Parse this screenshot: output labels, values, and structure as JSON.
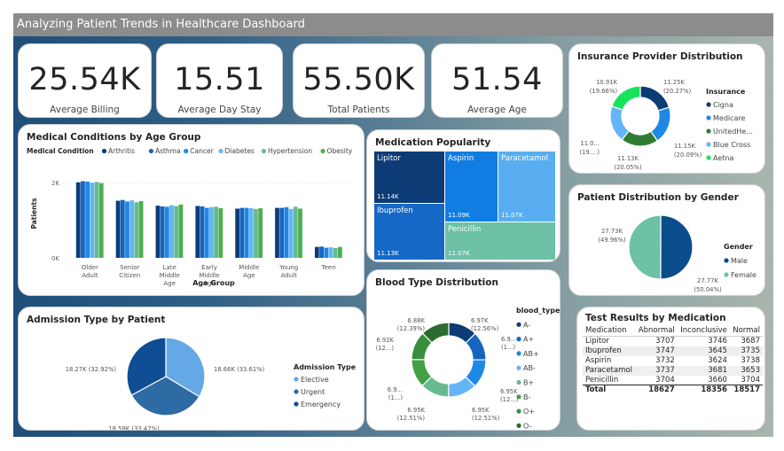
{
  "header": {
    "title": "Analyzing Patient Trends in Healthcare Dashboard"
  },
  "kpis": [
    {
      "value": "25.54K",
      "label": "Average Billing"
    },
    {
      "value": "15.51",
      "label": "Average Day Stay"
    },
    {
      "value": "55.50K",
      "label": "Total Patients"
    },
    {
      "value": "51.54",
      "label": "Average Age"
    }
  ],
  "medical_conditions": {
    "title": "Medical Conditions by Age Group",
    "legend_title": "Medical Condition",
    "xlabel": "Age Group",
    "ylabel": "Patients",
    "ytick_top": "2K",
    "ytick_bottom": "0K",
    "chart_data": {
      "type": "bar",
      "categories": [
        "Older Adult",
        "Senior Citizen",
        "Late Middle Age",
        "Early Middle Age",
        "Middle Age",
        "Young Adult",
        "Teen"
      ],
      "category_lines": [
        [
          "Older",
          "Adult"
        ],
        [
          "Senior",
          "Citizen"
        ],
        [
          "Late",
          "Middle",
          "Age"
        ],
        [
          "Early",
          "Middle",
          "Age"
        ],
        [
          "Middle",
          "Age"
        ],
        [
          "Young",
          "Adult"
        ],
        [
          "Teen"
        ]
      ],
      "series": [
        {
          "name": "Arthritis",
          "color": "#0b3d7a",
          "values": [
            2010,
            1520,
            1390,
            1380,
            1310,
            1330,
            290
          ]
        },
        {
          "name": "Asthma",
          "color": "#1565c0",
          "values": [
            2040,
            1540,
            1370,
            1370,
            1330,
            1330,
            300
          ]
        },
        {
          "name": "Cancer",
          "color": "#1e88e5",
          "values": [
            2030,
            1500,
            1360,
            1330,
            1330,
            1350,
            270
          ]
        },
        {
          "name": "Diabetes",
          "color": "#64b5f6",
          "values": [
            2000,
            1530,
            1400,
            1350,
            1320,
            1300,
            280
          ]
        },
        {
          "name": "Hypertension",
          "color": "#66bb8e",
          "values": [
            2020,
            1480,
            1380,
            1360,
            1300,
            1360,
            260
          ]
        },
        {
          "name": "Obesity",
          "color": "#4caf50",
          "values": [
            1990,
            1510,
            1420,
            1320,
            1320,
            1310,
            290
          ]
        }
      ],
      "ylim": [
        0,
        2500
      ]
    }
  },
  "medication_popularity": {
    "title": "Medication Popularity",
    "chart_data": {
      "type": "treemap",
      "items": [
        {
          "name": "Lipitor",
          "value": "11.14K",
          "color": "#0d3b75"
        },
        {
          "name": "Aspirin",
          "value": "11.09K",
          "color": "#117de2"
        },
        {
          "name": "Paracetamol",
          "value": "11.07K",
          "color": "#58aef0"
        },
        {
          "name": "Ibuprofen",
          "value": "11.13K",
          "color": "#1668c6"
        },
        {
          "name": "Penicillin",
          "value": "11.07K",
          "color": "#6cc1a6"
        }
      ]
    }
  },
  "insurance": {
    "title": "Insurance Provider Distribution",
    "legend_title": "Insurance",
    "chart_data": {
      "type": "pie",
      "donut": true,
      "slices": [
        {
          "name": "Cigna",
          "value": 11.25,
          "label": "11.25K",
          "pct": "(20.27%)",
          "color": "#0d3b75"
        },
        {
          "name": "Medicare",
          "value": 11.15,
          "label": "11.15K",
          "pct": "(20.09%)",
          "color": "#1e88e5"
        },
        {
          "name": "UnitedHe...",
          "value": 11.13,
          "label": "11.13K",
          "pct": "(20.05%)",
          "color": "#2e7d32"
        },
        {
          "name": "Blue Cross",
          "value": 11.0,
          "label": "11.0...",
          "pct": "(19....)",
          "color": "#64b5f6"
        },
        {
          "name": "Aetna",
          "value": 10.91,
          "label": "10.91K",
          "pct": "(19.66%)",
          "color": "#17e35a"
        }
      ]
    }
  },
  "gender": {
    "title": "Patient Distribution by Gender",
    "legend_title": "Gender",
    "chart_data": {
      "type": "pie",
      "slices": [
        {
          "name": "Male",
          "value": 27.77,
          "label": "27.77K",
          "pct": "(50.04%)",
          "color": "#0b4c8c"
        },
        {
          "name": "Female",
          "value": 27.73,
          "label": "27.73K",
          "pct": "(49.96%)",
          "color": "#6cc1a6"
        }
      ]
    }
  },
  "admission": {
    "title": "Admission Type by Patient",
    "legend_title": "Admission Type",
    "chart_data": {
      "type": "pie",
      "slices": [
        {
          "name": "Elective",
          "value": 18.66,
          "label": "18.66K (33.61%)",
          "color": "#64a9e6"
        },
        {
          "name": "Urgent",
          "value": 18.58,
          "label": "18.58K (33.47%)",
          "color": "#2e6aa3"
        },
        {
          "name": "Emergency",
          "value": 18.27,
          "label": "18.27K (32.92%)",
          "color": "#0f4d94"
        }
      ]
    }
  },
  "blood_type": {
    "title": "Blood Type Distribution",
    "legend_title": "blood_type",
    "chart_data": {
      "type": "pie",
      "donut": true,
      "slices": [
        {
          "name": "A-",
          "value": 6.97,
          "color": "#0d3b75"
        },
        {
          "name": "A+",
          "value": 6.9,
          "color": "#1565c0"
        },
        {
          "name": "AB+",
          "value": 6.95,
          "color": "#1e88e5"
        },
        {
          "name": "AB-",
          "value": 6.95,
          "color": "#64b5f6"
        },
        {
          "name": "B+",
          "value": 6.95,
          "color": "#66bb8e"
        },
        {
          "name": "B-",
          "value": 6.9,
          "color": "#43a047"
        },
        {
          "name": "O+",
          "value": 6.92,
          "color": "#388e3c"
        },
        {
          "name": "O-",
          "value": 6.88,
          "color": "#2e6b2e"
        }
      ],
      "labels": [
        {
          "line1": "6.97K",
          "line2": "(12.56%)"
        },
        {
          "line1": "6.9...",
          "line2": "(1...)"
        },
        {
          "line1": "6.95K",
          "line2": "(12...)"
        },
        {
          "line1": "6.95K",
          "line2": "(12.51%)"
        },
        {
          "line1": "6.95K",
          "line2": "(12.51%)"
        },
        {
          "line1": "6.9...",
          "line2": "(1...)"
        },
        {
          "line1": "6.92K",
          "line2": "(12...)"
        },
        {
          "line1": "6.88K",
          "line2": "(12.39%)"
        }
      ]
    }
  },
  "test_results": {
    "title": "Test Results by Medication",
    "columns": [
      "Medication",
      "Abnormal",
      "Inconclusive",
      "Normal"
    ],
    "rows": [
      [
        "Lipitor",
        "3707",
        "3746",
        "3687"
      ],
      [
        "Ibuprofen",
        "3747",
        "3645",
        "3735"
      ],
      [
        "Aspirin",
        "3732",
        "3624",
        "3738"
      ],
      [
        "Paracetamol",
        "3737",
        "3681",
        "3653"
      ],
      [
        "Penicillin",
        "3704",
        "3660",
        "3704"
      ]
    ],
    "total": [
      "Total",
      "18627",
      "18356",
      "18517"
    ]
  }
}
